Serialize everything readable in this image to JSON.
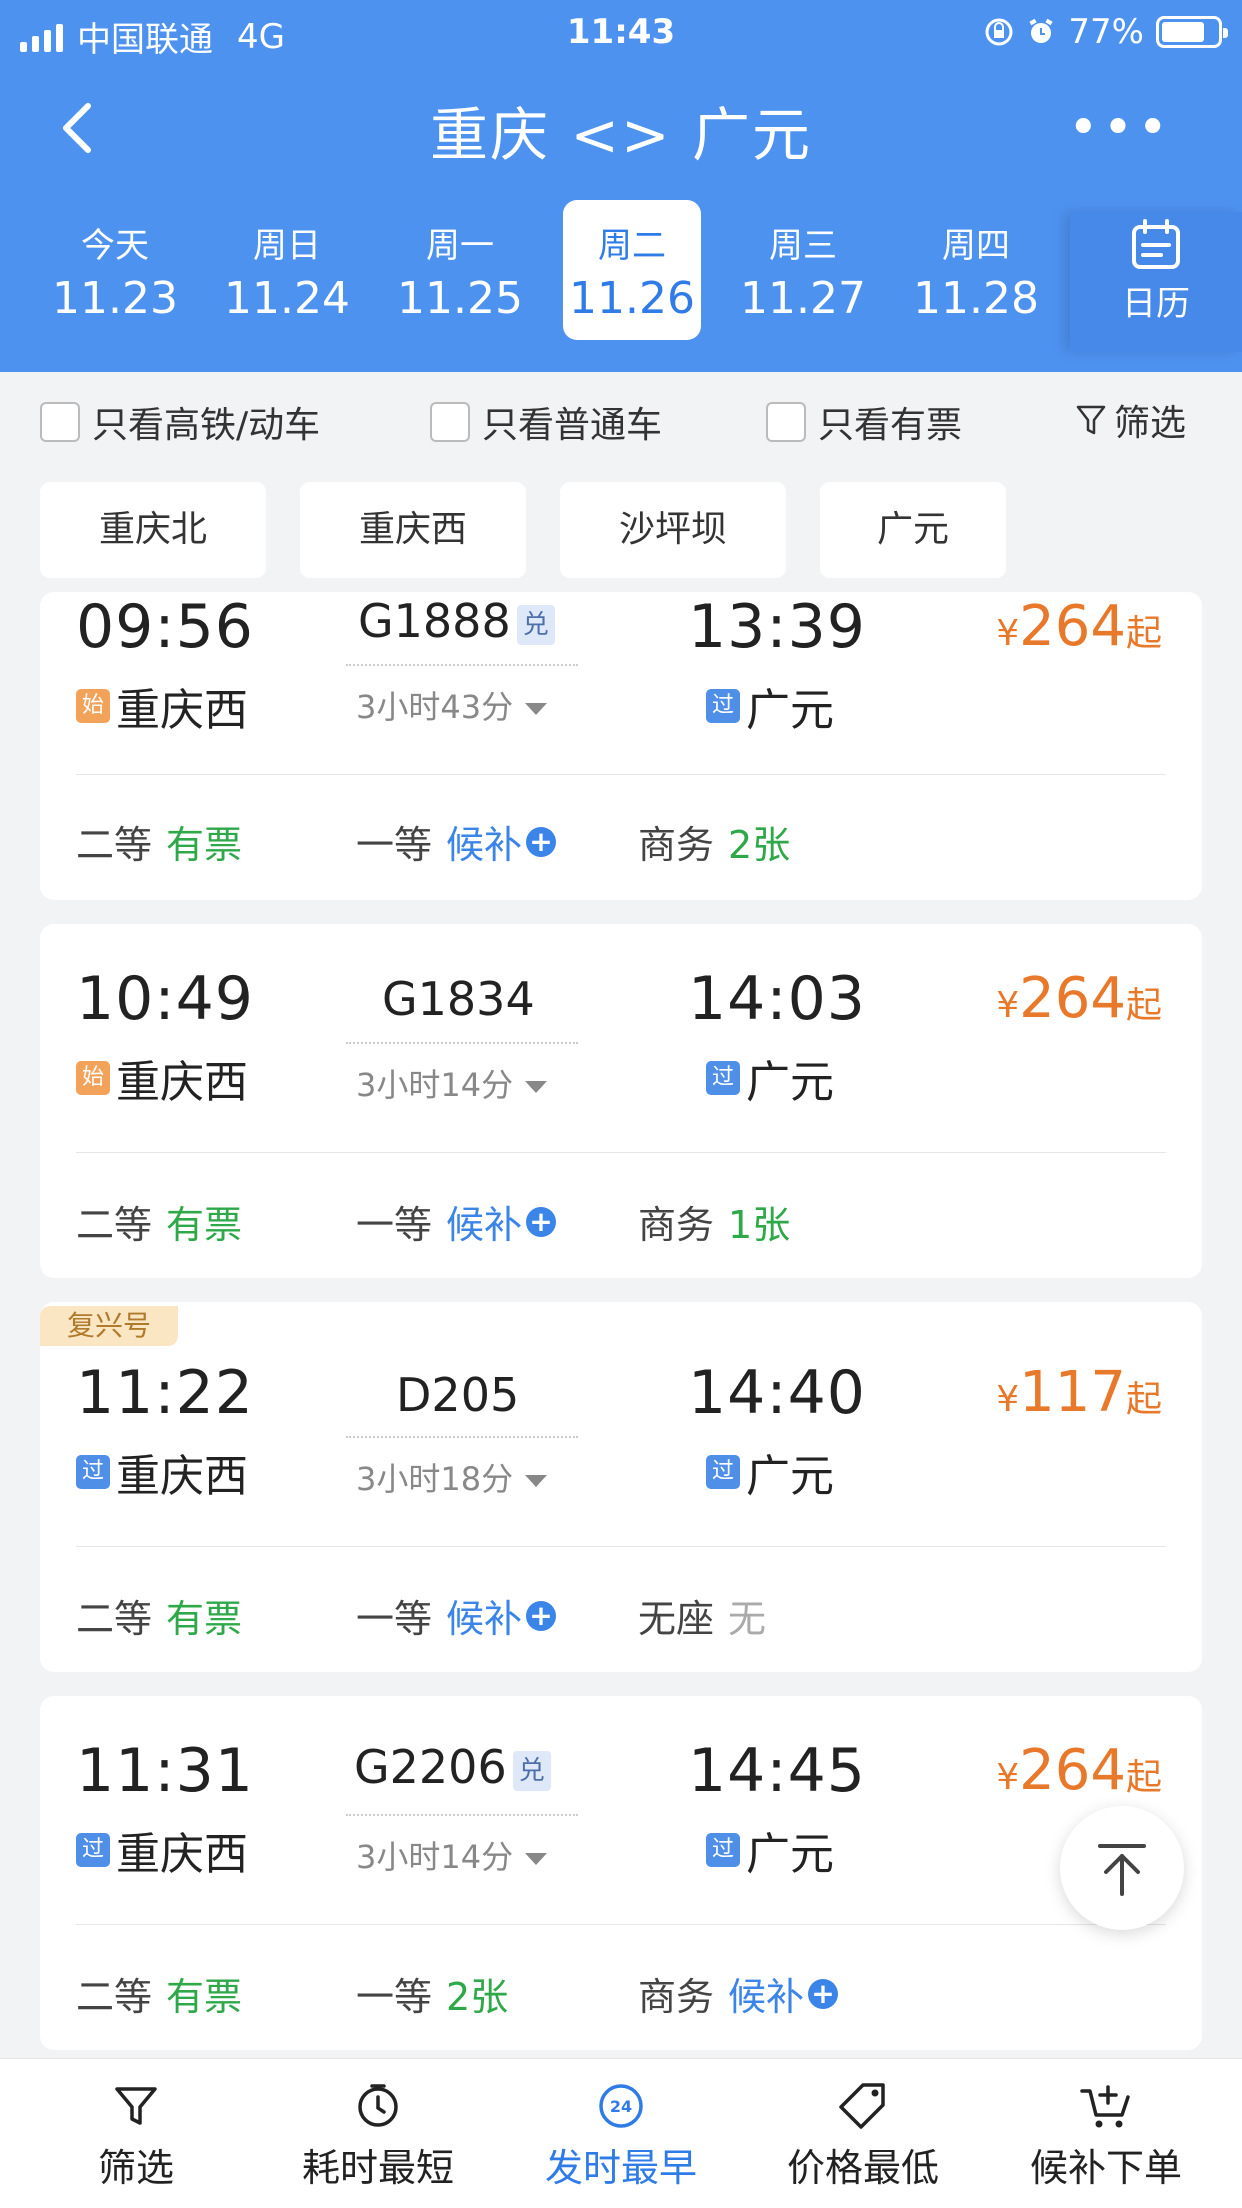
{
  "status_bar": {
    "carrier": "中国联通",
    "network": "4G",
    "time": "11:43",
    "battery": "77%",
    "battery_level": 0.77
  },
  "nav": {
    "title": "重庆 <> 广元"
  },
  "dates": [
    {
      "weekday": "今天",
      "date": "11.23"
    },
    {
      "weekday": "周日",
      "date": "11.24"
    },
    {
      "weekday": "周一",
      "date": "11.25"
    },
    {
      "weekday": "周二",
      "date": "11.26",
      "selected": true
    },
    {
      "weekday": "周三",
      "date": "11.27"
    },
    {
      "weekday": "周四",
      "date": "11.28"
    }
  ],
  "calendar_label": "日历",
  "filters": {
    "gaotie": "只看高铁/动车",
    "putong": "只看普通车",
    "youpiao": "只看有票",
    "screen": "筛选"
  },
  "stations": [
    "重庆北",
    "重庆西",
    "沙坪坝",
    "广元"
  ],
  "trains": [
    {
      "dep_time": "09:56",
      "dep_tag": "始",
      "dep_station": "重庆西",
      "train_no": "G1888",
      "badge": "兑",
      "duration": "3小时43分",
      "arr_time": "13:39",
      "arr_tag": "过",
      "arr_station": "广元",
      "price_symbol": "¥",
      "price": "264",
      "price_suffix": "起",
      "seats": [
        {
          "name": "二等",
          "status": "有票"
        },
        {
          "name": "一等",
          "status": "候补"
        },
        {
          "name": "商务",
          "status": "2张"
        }
      ]
    },
    {
      "dep_time": "10:49",
      "dep_tag": "始",
      "dep_station": "重庆西",
      "train_no": "G1834",
      "duration": "3小时14分",
      "arr_time": "14:03",
      "arr_tag": "过",
      "arr_station": "广元",
      "price_symbol": "¥",
      "price": "264",
      "price_suffix": "起",
      "seats": [
        {
          "name": "二等",
          "status": "有票"
        },
        {
          "name": "一等",
          "status": "候补"
        },
        {
          "name": "商务",
          "status": "1张"
        }
      ]
    },
    {
      "label": "复兴号",
      "dep_time": "11:22",
      "dep_tag": "过",
      "dep_station": "重庆西",
      "train_no": "D205",
      "duration": "3小时18分",
      "arr_time": "14:40",
      "arr_tag": "过",
      "arr_station": "广元",
      "price_symbol": "¥",
      "price": "117",
      "price_suffix": "起",
      "seats": [
        {
          "name": "二等",
          "status": "有票"
        },
        {
          "name": "一等",
          "status": "候补"
        },
        {
          "name": "无座",
          "status": "无"
        }
      ]
    },
    {
      "dep_time": "11:31",
      "dep_tag": "过",
      "dep_station": "重庆西",
      "train_no": "G2206",
      "badge": "兑",
      "duration": "3小时14分",
      "arr_time": "14:45",
      "arr_tag": "过",
      "arr_station": "广元",
      "price_symbol": "¥",
      "price": "264",
      "price_suffix": "起",
      "seats": [
        {
          "name": "二等",
          "status": "有票"
        },
        {
          "name": "一等",
          "status": "2张"
        },
        {
          "name": "商务",
          "status": "候补"
        }
      ]
    }
  ],
  "bottom_bar": {
    "filter": "筛选",
    "shortest": "耗时最短",
    "earliest": "发时最早",
    "earliest_icon_text": "24",
    "cheapest": "价格最低",
    "waitlist": "候补下单"
  },
  "colors": {
    "header_bg": "#4e92f0",
    "accent": "#2f7ce8",
    "price": "#e8782a",
    "available": "#2fa84a",
    "waitlist": "#3b84e8"
  }
}
